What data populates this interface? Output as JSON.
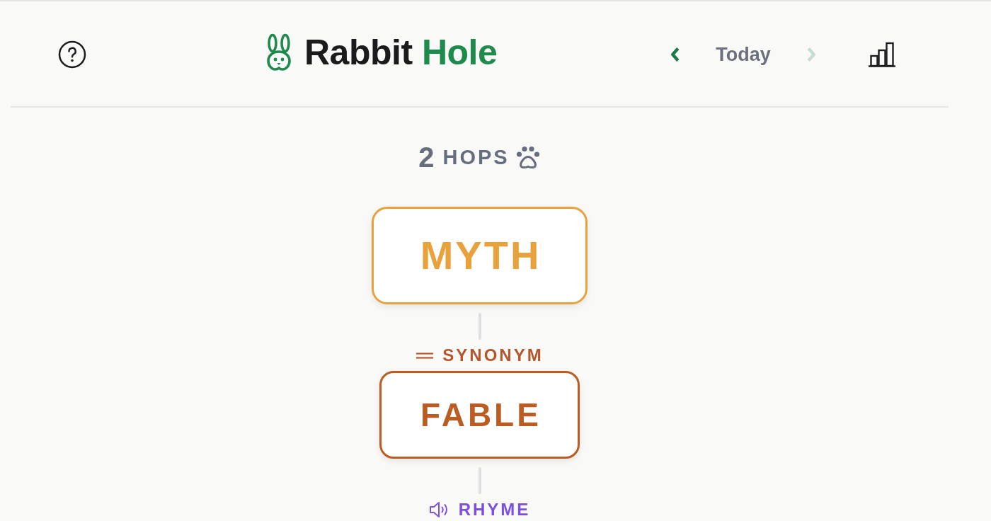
{
  "header": {
    "logo": {
      "word": "Rabbit",
      "accent": "Hole"
    },
    "date_nav": {
      "previous": {
        "disabled": false
      },
      "label": "Today",
      "next": {
        "disabled": true
      }
    }
  },
  "hops": {
    "count": "2",
    "label": "HOPS"
  },
  "chain": [
    {
      "kind": "word",
      "text": "MYTH",
      "color": "#e9a23b"
    },
    {
      "kind": "synonym",
      "label": "SYNONYM",
      "color": "#b5572c"
    },
    {
      "kind": "word",
      "text": "FABLE",
      "color": "#bb5c22"
    },
    {
      "kind": "rhyme",
      "label": "RHYME",
      "color": "#7b4fdf"
    }
  ]
}
